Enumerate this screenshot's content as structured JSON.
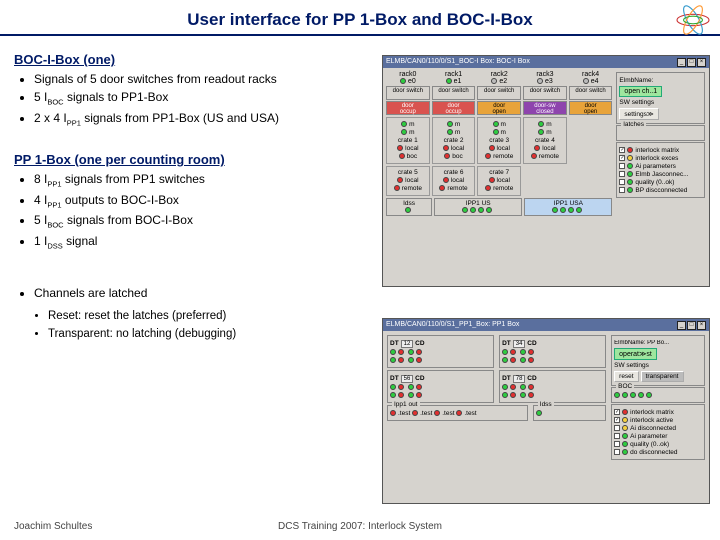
{
  "title": "User interface for PP 1-Box and BOC-I-Box",
  "section1": {
    "heading": "BOC-I-Box (one)",
    "items": [
      "Signals of 5 door switches from readout racks",
      "5 I_BOC signals to PP1-Box",
      "2 x 4 I_PP1 signals from PP1-Box (US and USA)"
    ]
  },
  "section2": {
    "heading": "PP 1-Box (one per counting room)",
    "items": [
      "8 I_PP1 signals from PP1 switches",
      "4 I_PP1 outputs to BOC-I-Box",
      "5 I_BOC signals from BOC-I-Box",
      "1 I_DSS signal"
    ]
  },
  "section3": {
    "bullet": "Channels are latched",
    "sub": [
      "Reset: reset the latches (preferred)",
      "Transparent: no latching (debugging)"
    ]
  },
  "footer_left": "Joachim Schultes",
  "footer_center": "DCS Training 2007: Interlock System",
  "win_boc": {
    "title": "ELMB/CAN0/110/0/S1_BOC-I Box: BOC-I Box",
    "racks": [
      "rack0",
      "rack1",
      "rack2",
      "rack3",
      "rack4"
    ],
    "doorlabel": "door switch",
    "racklabels": [
      "occup",
      "occup",
      "open",
      "closed",
      "open"
    ],
    "crate_a": [
      "crate 1",
      "crate 2",
      "crate 3",
      "crate 4"
    ],
    "crate_b": [
      "crate 5",
      "crate 6",
      "crate 7"
    ],
    "localrow": "local",
    "remote": "remote",
    "boc": "boc",
    "idss": "Idss",
    "pp_left": "IPP1 US",
    "pp_right": "IPP1 USA",
    "ports": [
      "e0",
      "e1",
      "e2",
      "e3",
      "e4"
    ],
    "right": {
      "elmbname": "ElmbName: ",
      "sw_settings": "SW settings",
      "settings_btn": "settings≫",
      "open_btn": "open ch..1",
      "latches": "latches",
      "checks": [
        "interlock matrix",
        "interlock exces",
        "Ai parameters",
        "Elmb Jasconnec...",
        "quality (0..ok)",
        "BP discconnected"
      ]
    }
  },
  "win_pp": {
    "title": "ELMB/CAN0/110/0/S1_PP1_Box: PP1 Box",
    "dt_labels": [
      "DT",
      "CD",
      "DT",
      "CD"
    ],
    "dt_nums": [
      "12",
      "34"
    ],
    "lower_labels": [
      "DT",
      "CD",
      "DT",
      "CD"
    ],
    "lower_nums": [
      "56",
      "78"
    ],
    "ipp_out": "Ipp1 out",
    "test_label": ".test",
    "idss": "Idss",
    "right": {
      "elmbname": "ElmbName: PP   Bo...",
      "sw_settings": "SW settings",
      "reset_btn": "reset",
      "operator_btn": "operat≫st",
      "transparent": "transparent",
      "boc_label": "BOC",
      "checks": [
        "interlock matrix",
        "interlock active",
        "Ai disconnected",
        "Ai parameter",
        "quality (0..ok)",
        "do disconnected"
      ]
    }
  }
}
